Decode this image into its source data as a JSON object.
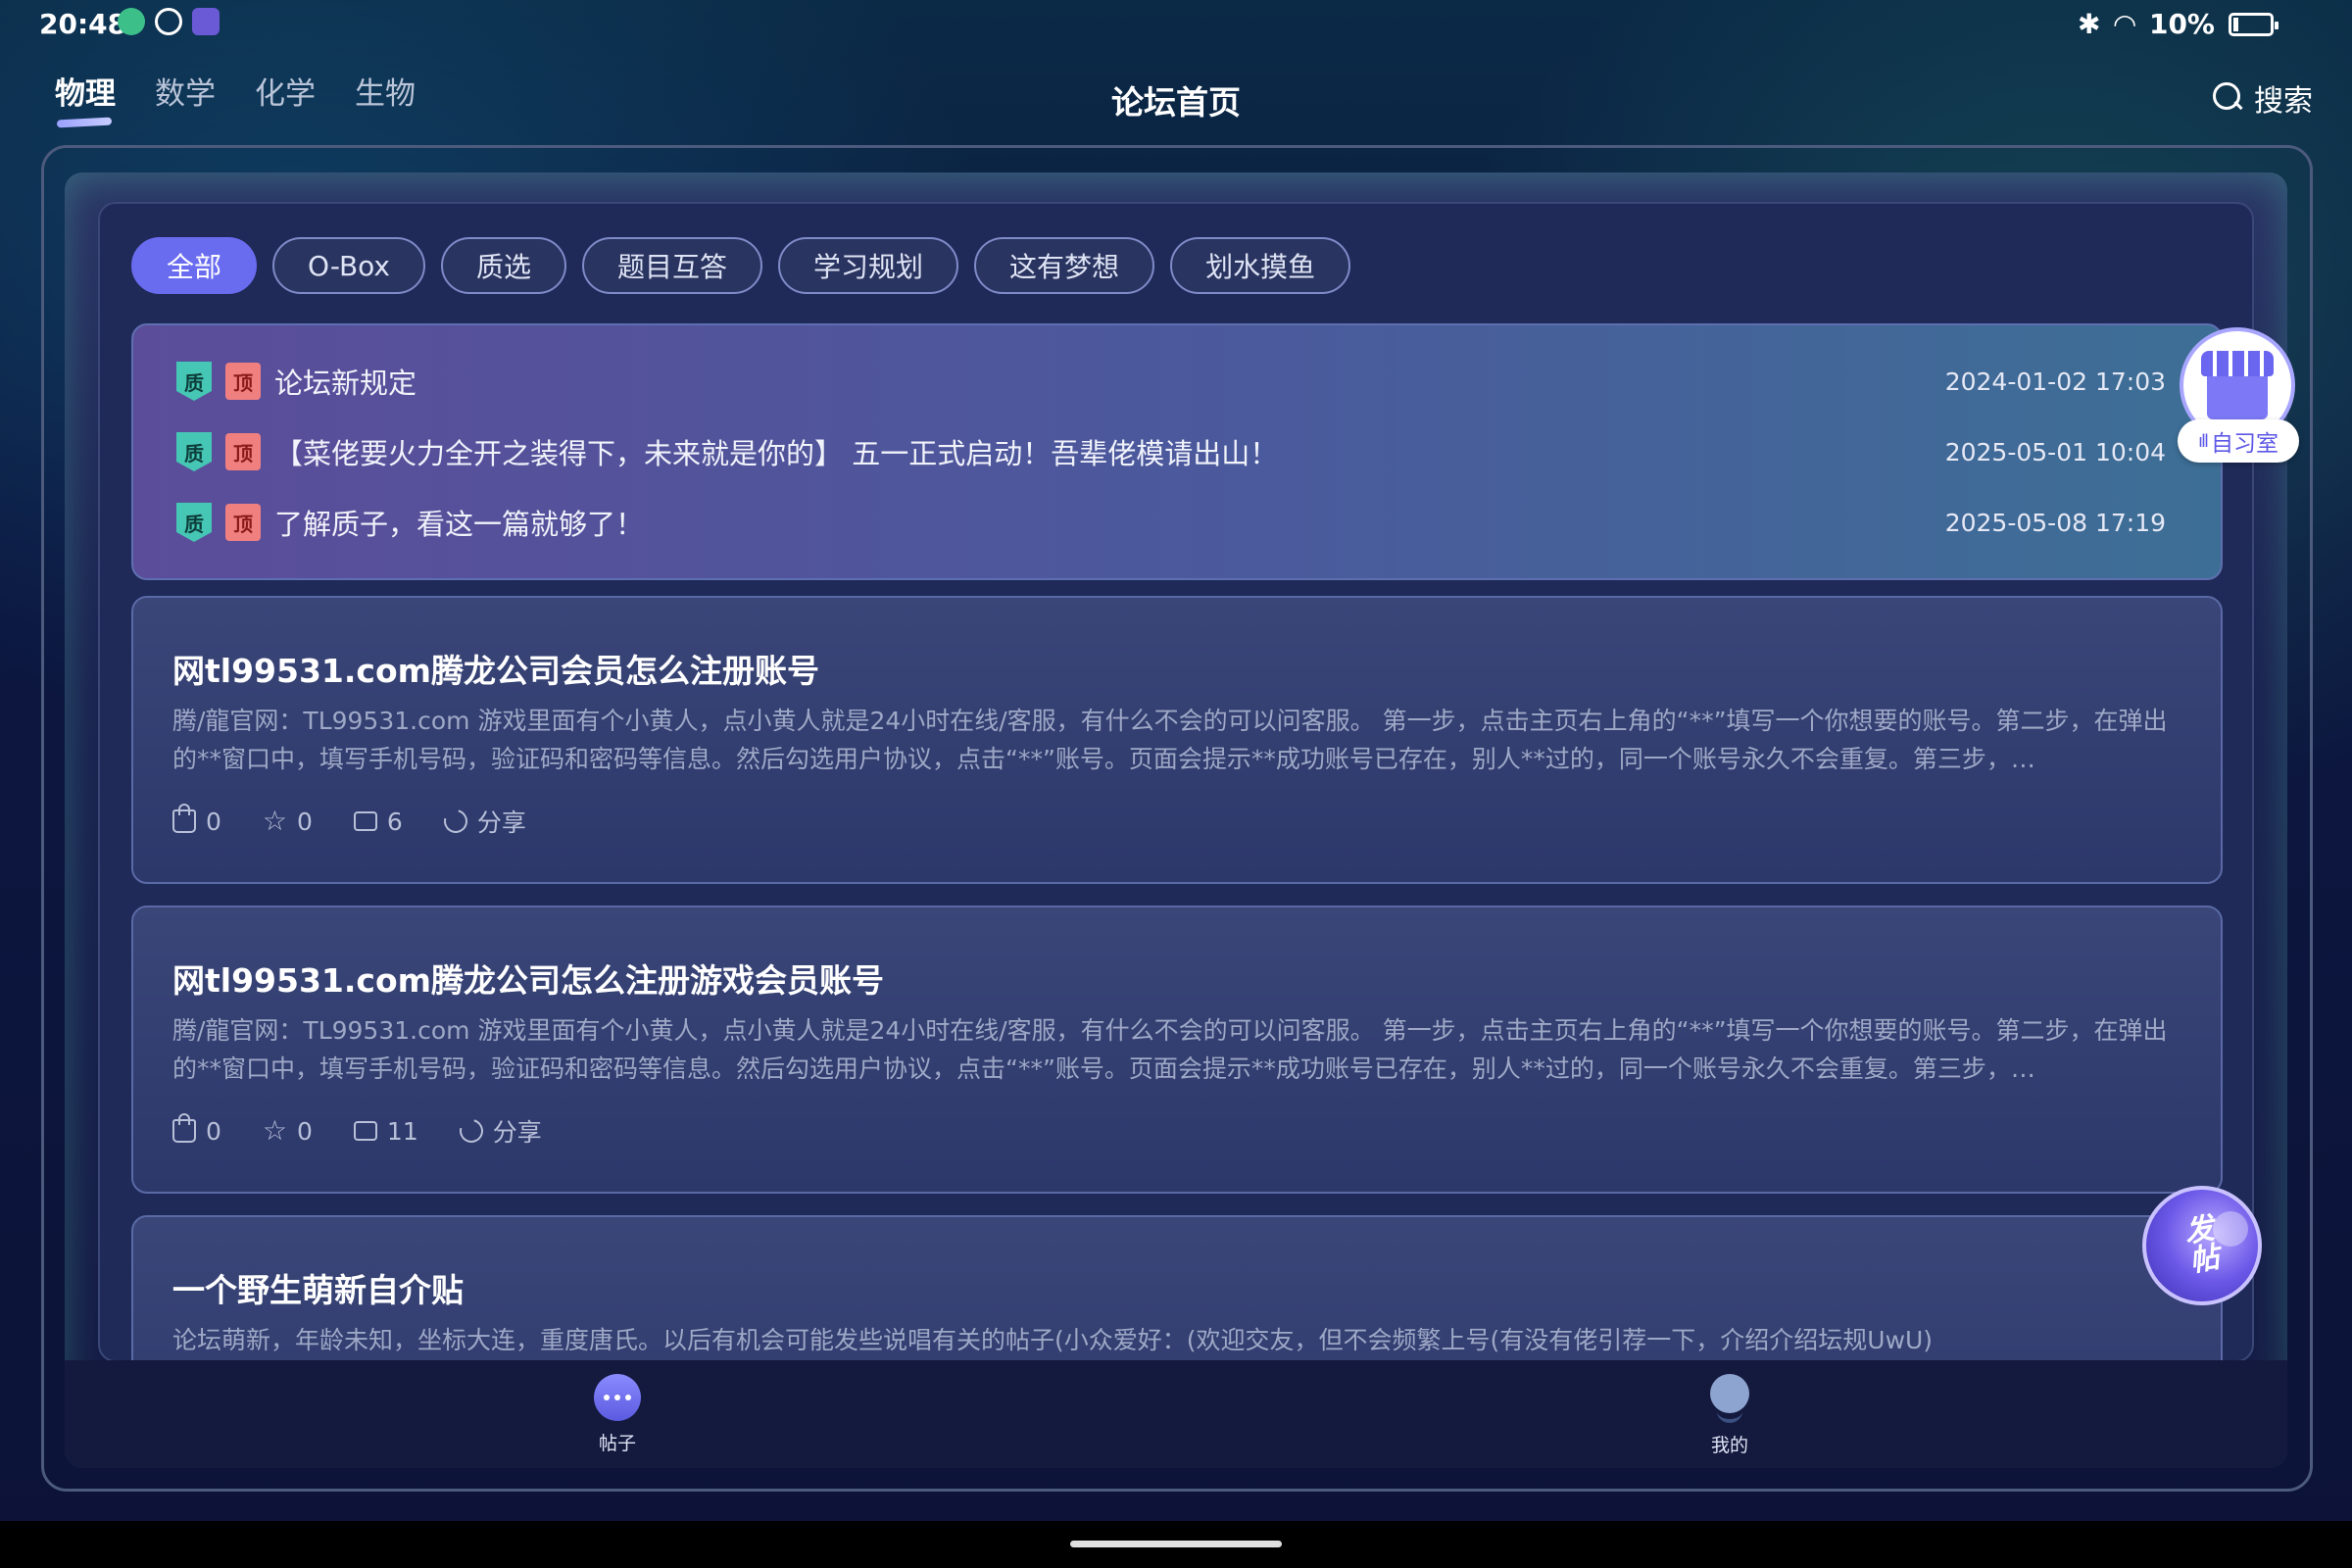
{
  "status_bar": {
    "time": "20:48",
    "battery": "10%"
  },
  "header": {
    "subjects": [
      "物理",
      "数学",
      "化学",
      "生物"
    ],
    "active_subject": "物理",
    "title": "论坛首页",
    "search_label": "搜索"
  },
  "categories": [
    "全部",
    "O-Box",
    "质选",
    "题目互答",
    "学习规划",
    "这有梦想",
    "划水摸鱼"
  ],
  "active_category": "全部",
  "pinned": [
    {
      "badge_quality": "质",
      "badge_top": "顶",
      "title": "论坛新规定",
      "time": "2024-01-02 17:03"
    },
    {
      "badge_quality": "质",
      "badge_top": "顶",
      "title": "【菜佬要火力全开之装得下，未来就是你的】 五一正式启动！吾辈佬模请出山！",
      "time": "2025-05-01 10:04"
    },
    {
      "badge_quality": "质",
      "badge_top": "顶",
      "title": "了解质子，看这一篇就够了！",
      "time": "2025-05-08 17:19"
    }
  ],
  "posts": [
    {
      "title": "网tl99531.com腾龙公司会员怎么注册账号",
      "body": "腾/龍官网：TL99531.com  游戏里面有个小黄人，点小黄人就是24小时在线/客服，有什么不会的可以问客服。 第一步，点击主页右上角的“**”填写一个你想要的账号。第二步，在弹出的**窗口中，填写手机号码，验证码和密码等信息。然后勾选用户协议，点击“**”账号。页面会提示**成功账号已存在，别人**过的，同一个账号永久不会重复。第三步，…",
      "likes": "0",
      "stars": "0",
      "comments": "6",
      "share": "分享"
    },
    {
      "title": "网tl99531.com腾龙公司怎么注册游戏会员账号",
      "body": "腾/龍官网：TL99531.com  游戏里面有个小黄人，点小黄人就是24小时在线/客服，有什么不会的可以问客服。 第一步，点击主页右上角的“**”填写一个你想要的账号。第二步，在弹出的**窗口中，填写手机号码，验证码和密码等信息。然后勾选用户协议，点击“**”账号。页面会提示**成功账号已存在，别人**过的，同一个账号永久不会重复。第三步，…",
      "likes": "0",
      "stars": "0",
      "comments": "11",
      "share": "分享"
    },
    {
      "title": "一个野生萌新自介贴",
      "body": "论坛萌新，年龄未知，坐标大连，重度唐氏。以后有机会可能发些说唱有关的帖子(小众爱好：(欢迎交友，但不会频繁上号(有没有佬引荐一下，介绍介绍坛规UwU)"
    }
  ],
  "floating": {
    "study_room": "自习室",
    "post_button": "发帖"
  },
  "bottom_nav": {
    "posts": "帖子",
    "me": "我的"
  }
}
